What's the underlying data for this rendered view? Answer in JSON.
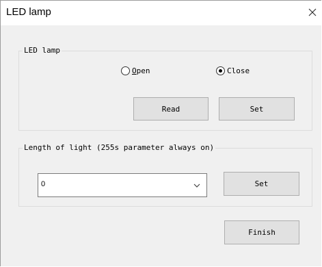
{
  "window": {
    "title": "LED lamp"
  },
  "led_group": {
    "legend": "LED lamp",
    "options": [
      {
        "label": "Open",
        "checked": false
      },
      {
        "label": "Close",
        "checked": true
      }
    ],
    "read_label": "Read",
    "set_label": "Set"
  },
  "length_group": {
    "legend": "Length of light (255s parameter always on)",
    "selected_value": "0",
    "set_label": "Set"
  },
  "finish_label": "Finish"
}
